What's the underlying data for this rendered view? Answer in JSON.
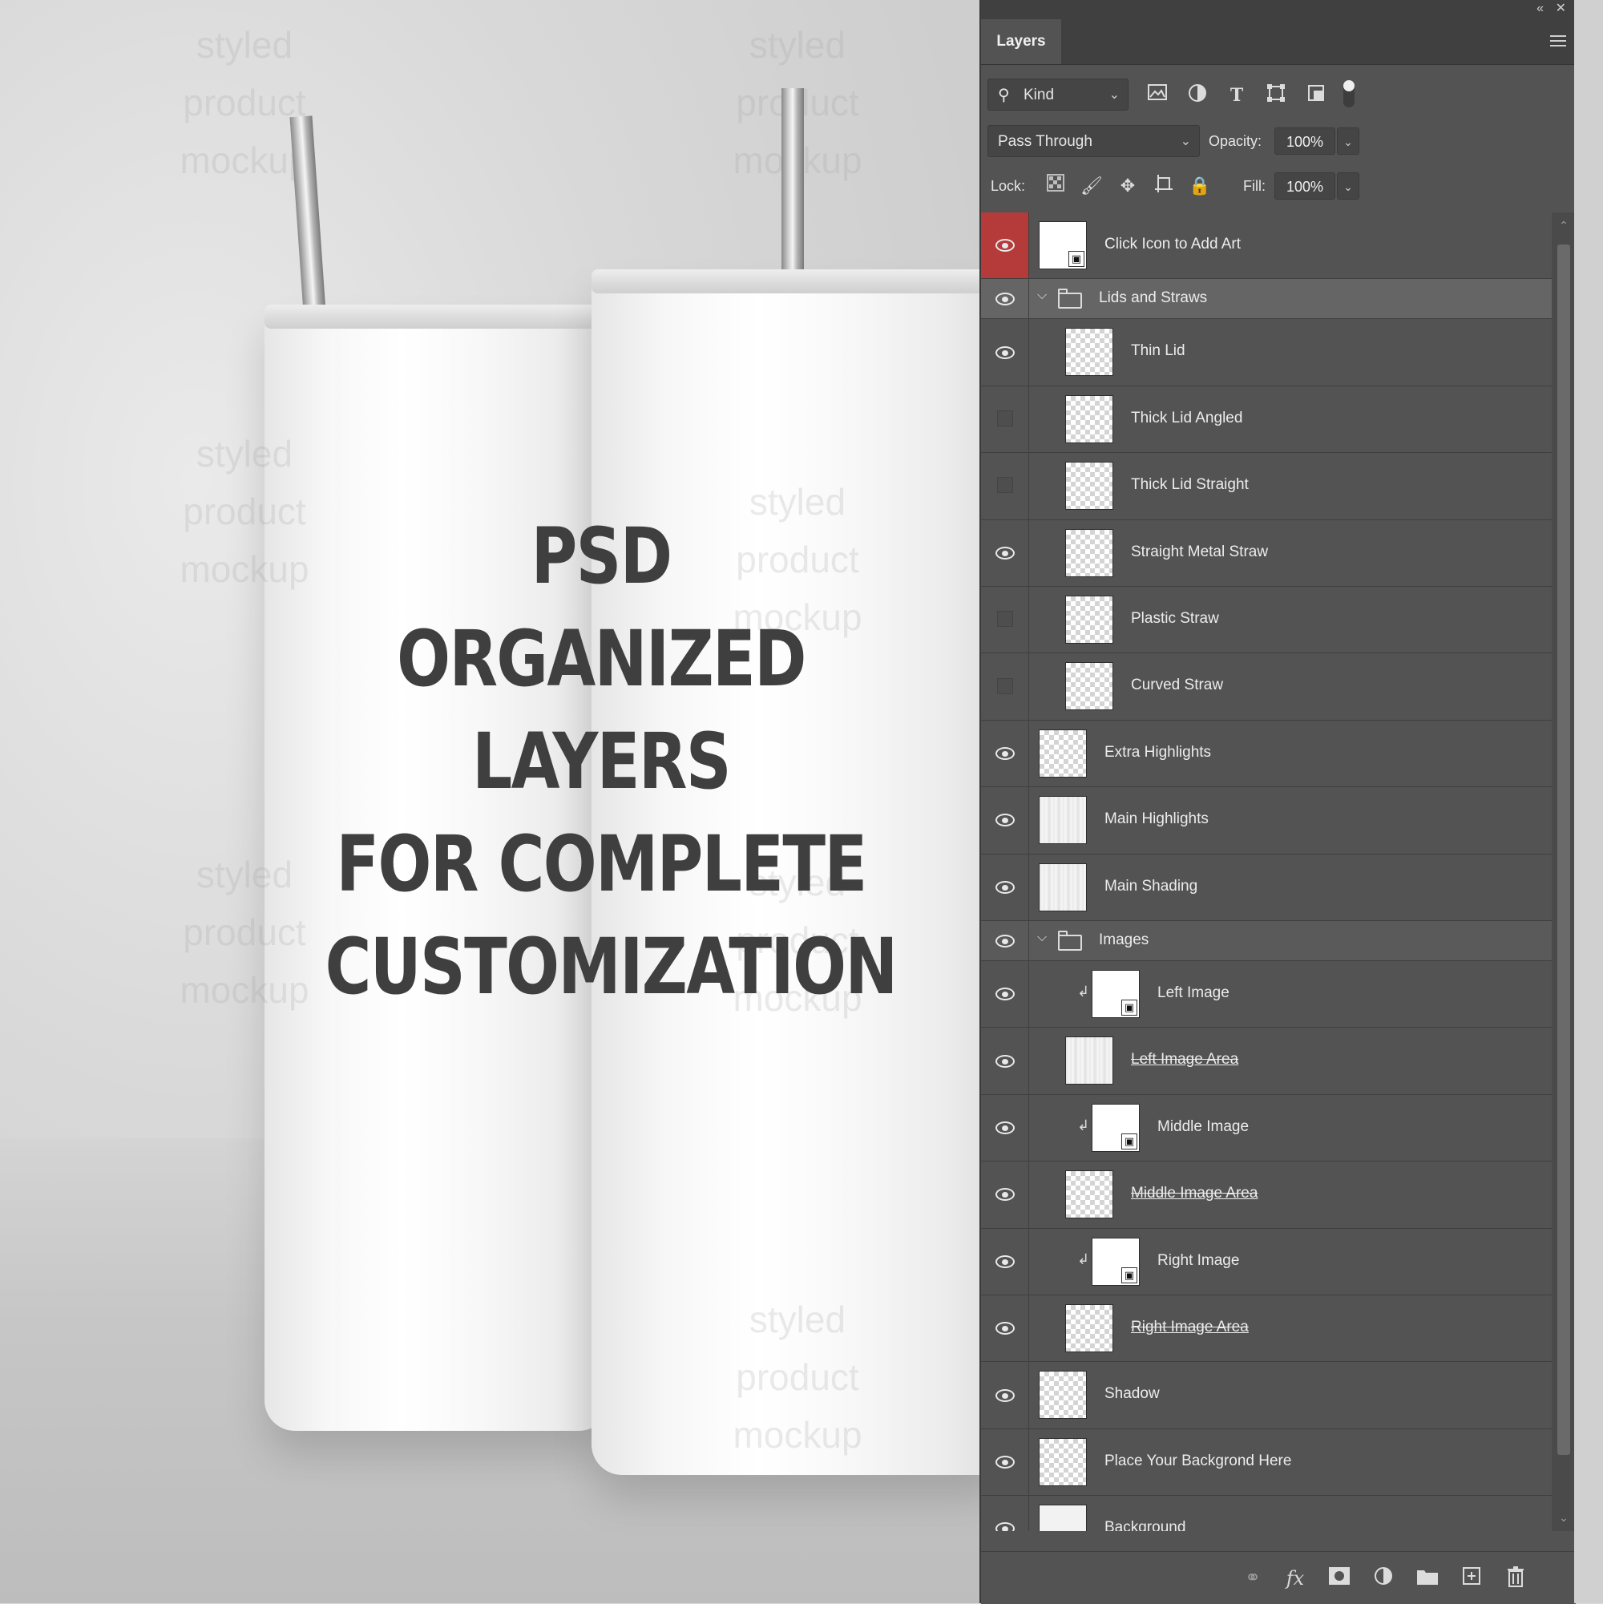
{
  "mockup": {
    "headline_lines": [
      "PSD ORGANIZED LAYERS",
      "FOR COMPLETE",
      "CUSTOMIZATION"
    ],
    "watermark_lines": [
      "styled",
      "product",
      "mockup"
    ]
  },
  "panel": {
    "tab_label": "Layers",
    "collapse_icon": "double-chevron-left-icon",
    "close_icon": "close-icon",
    "filter": {
      "kind_label": "Kind",
      "filter_icons": [
        "pixel-filter-icon",
        "adjustment-filter-icon",
        "type-filter-icon",
        "shape-filter-icon",
        "smart-object-filter-icon"
      ]
    },
    "blend_mode": "Pass Through",
    "opacity_label": "Opacity:",
    "opacity_value": "100%",
    "lock_label": "Lock:",
    "fill_label": "Fill:",
    "fill_value": "100%",
    "layers": [
      {
        "name": "Click Icon to Add Art",
        "visible": true,
        "highlight": true,
        "indent": 0,
        "thumb": "smart",
        "strike": false
      },
      {
        "name": "Lids and Straws",
        "visible": true,
        "group": true,
        "indent": 0,
        "selected": true
      },
      {
        "name": "Thin Lid",
        "visible": true,
        "indent": 1,
        "thumb": "checker"
      },
      {
        "name": "Thick Lid Angled",
        "visible": false,
        "indent": 1,
        "thumb": "checker"
      },
      {
        "name": "Thick Lid Straight",
        "visible": false,
        "indent": 1,
        "thumb": "checker"
      },
      {
        "name": "Straight Metal Straw",
        "visible": true,
        "indent": 1,
        "thumb": "checker"
      },
      {
        "name": "Plastic Straw",
        "visible": false,
        "indent": 1,
        "thumb": "checker"
      },
      {
        "name": "Curved Straw",
        "visible": false,
        "indent": 1,
        "thumb": "checker"
      },
      {
        "name": "Extra Highlights",
        "visible": true,
        "indent": 0,
        "thumb": "checker"
      },
      {
        "name": "Main Highlights",
        "visible": true,
        "indent": 0,
        "thumb": "bars"
      },
      {
        "name": "Main Shading",
        "visible": true,
        "indent": 0,
        "thumb": "bars"
      },
      {
        "name": "Images",
        "visible": true,
        "group": true,
        "indent": 0
      },
      {
        "name": "Left Image",
        "visible": true,
        "indent": 2,
        "thumb": "smart",
        "clipped": true
      },
      {
        "name": "Left Image Area",
        "visible": true,
        "indent": 1,
        "thumb": "bars",
        "strike": true
      },
      {
        "name": "Middle Image",
        "visible": true,
        "indent": 2,
        "thumb": "smart",
        "clipped": true
      },
      {
        "name": "Middle Image Area",
        "visible": true,
        "indent": 1,
        "thumb": "checker",
        "strike": true
      },
      {
        "name": "Right Image",
        "visible": true,
        "indent": 2,
        "thumb": "smart",
        "clipped": true
      },
      {
        "name": "Right Image Area",
        "visible": true,
        "indent": 1,
        "thumb": "checker",
        "strike": true
      },
      {
        "name": "Shadow",
        "visible": true,
        "indent": 0,
        "thumb": "checker"
      },
      {
        "name": "Place Your Backgrond Here",
        "visible": true,
        "indent": 0,
        "thumb": "checker"
      },
      {
        "name": "Background",
        "visible": true,
        "indent": 0,
        "thumb": "solid"
      }
    ],
    "footer_icons": [
      "link-layers-icon",
      "fx-icon",
      "layer-mask-icon",
      "adjustment-layer-icon",
      "new-group-icon",
      "new-layer-icon",
      "delete-icon"
    ],
    "footer_fx_label": "fx"
  }
}
